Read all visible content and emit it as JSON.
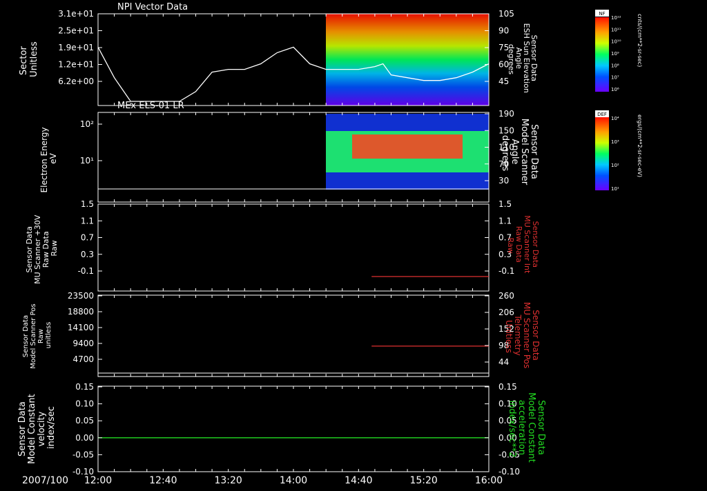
{
  "chart_data": [
    {
      "type": "line",
      "title": "NPI Vector Data",
      "ylabel_left": [
        "Sector",
        "Unitless"
      ],
      "ylabel_right": [
        "Sensor Data",
        "ESH Sun Elevation",
        "Angle",
        "degrees"
      ],
      "yticks_left": [
        "3.1e+01",
        "2.5e+01",
        "1.9e+01",
        "1.2e+01",
        "6.2e+00"
      ],
      "yticks_right": [
        "105",
        "90",
        "75",
        "60",
        "45"
      ],
      "series": [
        {
          "x": [
            "12:00",
            "12:10",
            "12:20",
            "12:30",
            "12:40",
            "12:50",
            "13:00",
            "13:10",
            "13:20",
            "13:30",
            "13:40",
            "13:50",
            "14:00",
            "14:10",
            "14:20",
            "14:30",
            "14:40",
            "14:50",
            "14:55",
            "15:00",
            "15:10",
            "15:20",
            "15:30",
            "15:40",
            "15:50",
            "16:00"
          ],
          "values": [
            21,
            10,
            1.5,
            1.5,
            1.5,
            1.5,
            5,
            12,
            13,
            13,
            15,
            19,
            21,
            15,
            13,
            13,
            13,
            14,
            15,
            11,
            10,
            9,
            9,
            10,
            12,
            15
          ]
        }
      ],
      "spectrogram": {
        "start": "14:50",
        "end": "16:00",
        "colormap": "rainbow"
      }
    },
    {
      "type": "heatmap",
      "title": "MEx ELS-01 LR",
      "ylabel_left": [
        "Electron Energy",
        "eV"
      ],
      "ylabel_right": [
        "Sensor Data",
        "Model Scanner",
        "Angle",
        "degrees"
      ],
      "yticks_left": [
        "10²",
        "10¹"
      ],
      "yticks_right": [
        "190",
        "150",
        "110",
        "70",
        "30"
      ],
      "start": "14:50",
      "end": "16:00"
    },
    {
      "type": "line",
      "ylabel_left": [
        "Sensor Data",
        "MU Scanner +30V",
        "Raw Data",
        "Raw"
      ],
      "ylabel_right": [
        "Sensor Data",
        "MU Scanner Int",
        "Raw Data",
        "Raw"
      ],
      "yticks": [
        "1.5",
        "1.1",
        "0.7",
        "0.3",
        "-0.1"
      ],
      "ylim": [
        -0.3,
        1.5
      ],
      "series": [
        {
          "color": "#e03030",
          "start": "14:48",
          "end": "16:00",
          "value": 0.0
        }
      ]
    },
    {
      "type": "line",
      "ylabel_left": [
        "Sensor Data",
        "Model Scanner Pos",
        "Raw",
        "unitless"
      ],
      "ylabel_right": [
        "Sensor Data",
        "MU Scanner Pos",
        "Telemetry",
        "Unitless"
      ],
      "yticks_left": [
        "23500",
        "18800",
        "14100",
        "9400",
        "4700"
      ],
      "yticks_right": [
        "260",
        "206",
        "152",
        "98",
        "44"
      ],
      "ylim_right": [
        0,
        260
      ],
      "series": [
        {
          "color": "#e03030",
          "start": "14:48",
          "end": "16:00",
          "value": 98
        }
      ]
    },
    {
      "type": "line",
      "ylabel_left": [
        "Sensor Data",
        "Model Constant",
        "velocity",
        "index/sec"
      ],
      "ylabel_right": [
        "Sensor Data",
        "Model Constant",
        "acceleration",
        "index/sec**2"
      ],
      "yticks": [
        "0.15",
        "0.10",
        "0.05",
        "0.00",
        "-0.05",
        "-0.10"
      ],
      "ylim": [
        -0.1,
        0.15
      ],
      "series": [
        {
          "color": "#22dd22",
          "start": "12:00",
          "end": "16:00",
          "value": 0.0
        }
      ]
    }
  ],
  "xaxis": {
    "date": "2007/100",
    "ticks": [
      "12:00",
      "12:40",
      "13:20",
      "14:00",
      "14:40",
      "15:20",
      "16:00"
    ]
  },
  "colorbars": [
    {
      "tag": "NF",
      "label": "cnts/(cm**2-sr-sec)",
      "ticks": [
        "10¹²",
        "10¹¹",
        "10¹⁰",
        "10⁹",
        "10⁸",
        "10⁷",
        "10⁶"
      ]
    },
    {
      "tag": "DEF",
      "label": "ergs/(cm**2-sr-sec-eV)",
      "ticks": [
        "10⁴",
        "10³",
        "10²",
        "10¹"
      ]
    }
  ],
  "colors": {
    "red": "#e03030",
    "green": "#22dd22"
  }
}
